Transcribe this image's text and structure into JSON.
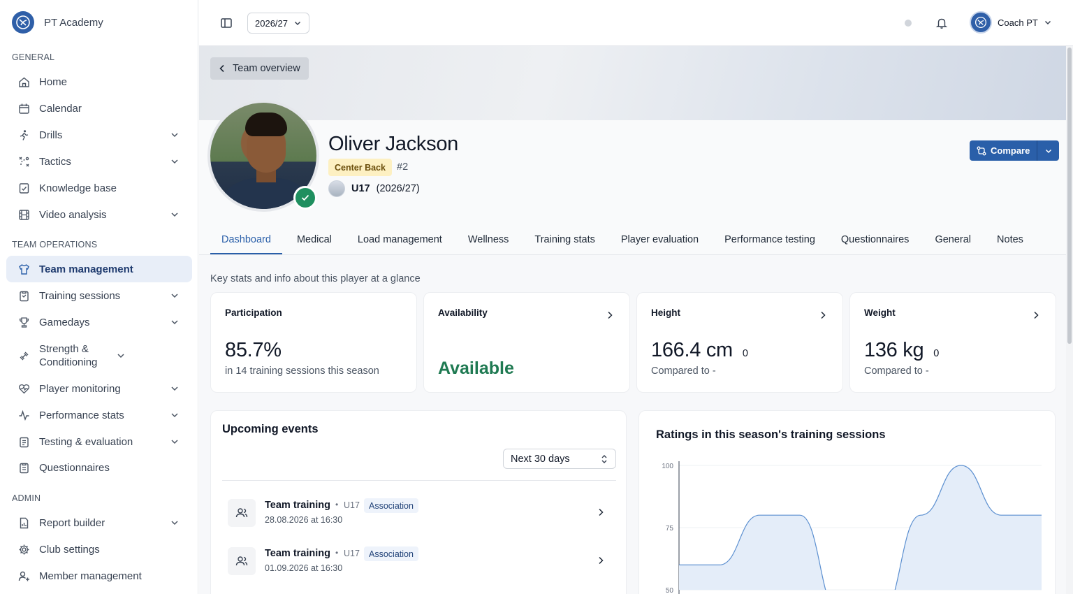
{
  "app": {
    "name": "PT Academy"
  },
  "sidebar": {
    "sections": {
      "general": "GENERAL",
      "team_operations": "TEAM OPERATIONS",
      "admin": "ADMIN"
    },
    "general_items": [
      {
        "label": "Home",
        "icon": "home-icon"
      },
      {
        "label": "Calendar",
        "icon": "calendar-icon"
      },
      {
        "label": "Drills",
        "icon": "drills-icon"
      },
      {
        "label": "Tactics",
        "icon": "tactics-icon"
      },
      {
        "label": "Knowledge base",
        "icon": "book-icon"
      },
      {
        "label": "Video analysis",
        "icon": "film-icon"
      }
    ],
    "team_items": [
      {
        "label": "Team management",
        "icon": "shirt-icon"
      },
      {
        "label": "Training sessions",
        "icon": "clipboard-icon"
      },
      {
        "label": "Gamedays",
        "icon": "trophy-icon"
      },
      {
        "label": "Strength & Conditioning",
        "icon": "dumbbell-icon"
      },
      {
        "label": "Player monitoring",
        "icon": "heart-icon"
      },
      {
        "label": "Performance stats",
        "icon": "activity-icon"
      },
      {
        "label": "Testing & evaluation",
        "icon": "checklist-icon"
      },
      {
        "label": "Questionnaires",
        "icon": "form-icon"
      }
    ],
    "admin_items": [
      {
        "label": "Report builder",
        "icon": "report-icon"
      },
      {
        "label": "Club settings",
        "icon": "gear-icon"
      },
      {
        "label": "Member management",
        "icon": "users-icon"
      }
    ]
  },
  "topbar": {
    "season": "2026/27",
    "user_name": "Coach PT"
  },
  "player": {
    "back_label": "Team overview",
    "name": "Oliver Jackson",
    "position": "Center Back",
    "number": "#2",
    "team": "U17",
    "season": "(2026/27)",
    "compare_label": "Compare"
  },
  "tabs": [
    "Dashboard",
    "Medical",
    "Load management",
    "Wellness",
    "Training stats",
    "Player evaluation",
    "Performance testing",
    "Questionnaires",
    "General",
    "Notes"
  ],
  "intro": "Key stats and info about this player at a glance",
  "stats": {
    "participation": {
      "title": "Participation",
      "value": "85.7%",
      "sub": "in 14 training sessions this season"
    },
    "availability": {
      "title": "Availability",
      "value": "Available"
    },
    "height": {
      "title": "Height",
      "value": "166.4 cm",
      "delta": "0",
      "sub": "Compared to -"
    },
    "weight": {
      "title": "Weight",
      "value": "136 kg",
      "delta": "0",
      "sub": "Compared to -"
    }
  },
  "events": {
    "title": "Upcoming events",
    "range": "Next 30 days",
    "items": [
      {
        "title": "Team training",
        "team": "U17",
        "tag": "Association",
        "date": "28.08.2026 at 16:30"
      },
      {
        "title": "Team training",
        "team": "U17",
        "tag": "Association",
        "date": "01.09.2026 at 16:30"
      }
    ]
  },
  "chart_data": {
    "type": "area",
    "title": "Ratings in this season's training sessions",
    "xlabel": "",
    "ylabel": "",
    "yticks": [
      "100",
      "75",
      "50"
    ],
    "ylim": [
      50,
      100
    ],
    "values": [
      60,
      60,
      80,
      80,
      40,
      40,
      80,
      100,
      80,
      80
    ],
    "color": "#5b8fd0",
    "fill": "#e4edf9"
  }
}
